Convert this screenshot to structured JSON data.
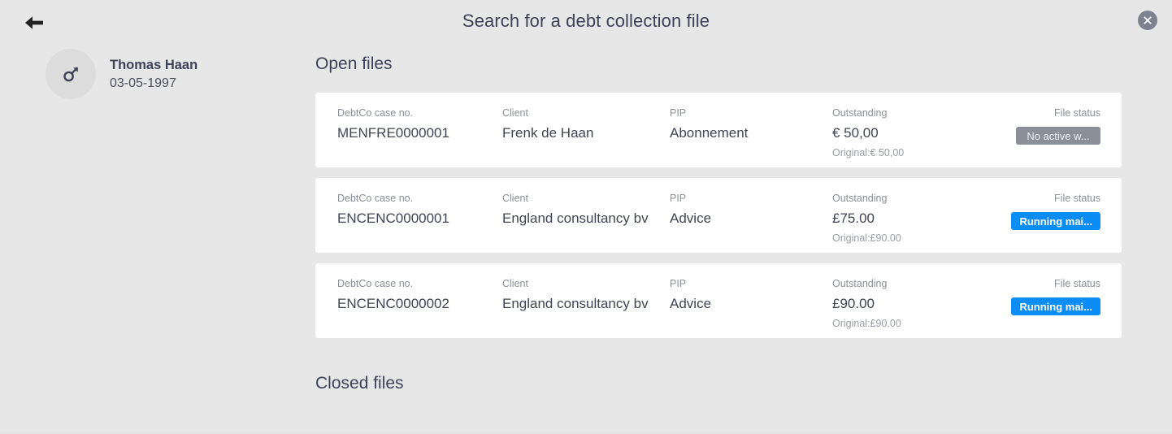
{
  "header": {
    "title": "Search for a debt collection file",
    "back_icon": "arrow-left-icon",
    "close_icon": "close-circle-icon"
  },
  "patient": {
    "gender_icon": "male-gender-icon",
    "name": "Thomas Haan",
    "date_of_birth": "03-05-1997"
  },
  "sections": {
    "open_files_heading": "Open files",
    "closed_files_heading": "Closed files"
  },
  "columns": {
    "case_no": "DebtCo case no.",
    "client": "Client",
    "pip": "PIP",
    "outstanding": "Outstanding",
    "file_status": "File status"
  },
  "colors": {
    "page_background": "#e7e7e7",
    "card_background": "#ffffff",
    "text_primary": "#3c4257",
    "text_muted": "#8a8f9a",
    "badge_grey": "#8a8f99",
    "badge_blue": "#0c8cf5"
  },
  "open_files": [
    {
      "case_no": "MENFRE0000001",
      "client": "Frenk de Haan",
      "pip": "Abonnement",
      "outstanding": "€ 50,00",
      "original": "Original:€ 50,00",
      "status": "No active w...",
      "status_style": "grey"
    },
    {
      "case_no": "ENCENC0000001",
      "client": "England consultancy bv",
      "pip": "Advice",
      "outstanding": "£75.00",
      "original": "Original:£90.00",
      "status": "Running mai...",
      "status_style": "blue"
    },
    {
      "case_no": "ENCENC0000002",
      "client": "England consultancy bv",
      "pip": "Advice",
      "outstanding": "£90.00",
      "original": "Original:£90.00",
      "status": "Running mai...",
      "status_style": "blue"
    }
  ]
}
